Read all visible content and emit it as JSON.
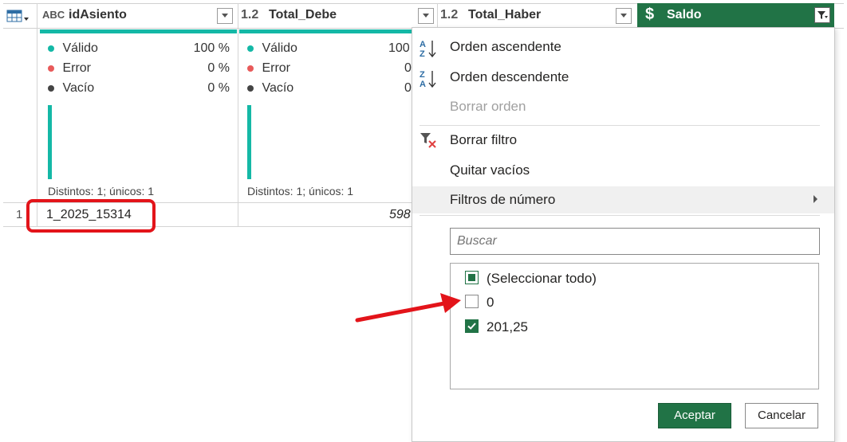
{
  "table": {
    "columns": [
      {
        "type": "ABC",
        "name": "idAsiento",
        "valid_label": "Válido",
        "valid_pct": "100 %",
        "error_label": "Error",
        "error_pct": "0 %",
        "empty_label": "Vacío",
        "empty_pct": "0 %",
        "distinct": "Distintos: 1; únicos: 1",
        "cell": "1_2025_15314"
      },
      {
        "type": "1.2",
        "name": "Total_Debe",
        "valid_label": "Válido",
        "valid_pct": "100",
        "error_label": "Error",
        "error_pct": "0",
        "empty_label": "Vacío",
        "empty_pct": "0",
        "distinct": "Distintos: 1; únicos: 1",
        "cell": "598"
      },
      {
        "type": "1.2",
        "name": "Total_Haber"
      },
      {
        "type": "$",
        "name": "Saldo"
      }
    ],
    "row_number": "1"
  },
  "menu": {
    "sort_asc": "Orden ascendente",
    "sort_desc": "Orden descendente",
    "clear_sort": "Borrar orden",
    "clear_filter": "Borrar filtro",
    "remove_empty": "Quitar vacíos",
    "number_filters": "Filtros de número",
    "search_placeholder": "Buscar",
    "items": [
      {
        "label": "(Seleccionar todo)",
        "state": "partial"
      },
      {
        "label": "0",
        "state": "unchecked"
      },
      {
        "label": "201,25",
        "state": "checked"
      }
    ],
    "accept": "Aceptar",
    "cancel": "Cancelar"
  },
  "colors": {
    "accent": "#217346",
    "teal": "#14b8a6",
    "highlight": "#e3141a"
  }
}
